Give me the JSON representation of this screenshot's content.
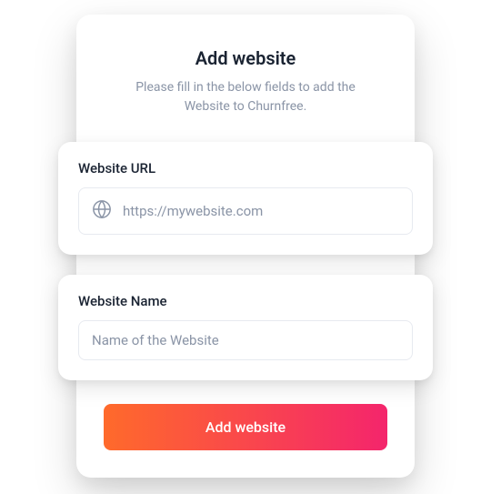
{
  "modal": {
    "title": "Add website",
    "subtitle": "Please fill in the below fields to add the Website to Churnfree."
  },
  "fields": {
    "url": {
      "label": "Website URL",
      "placeholder": "https://mywebsite.com",
      "value": ""
    },
    "name": {
      "label": "Website Name",
      "placeholder": "Name of the Website",
      "value": ""
    }
  },
  "button": {
    "submit_label": "Add website"
  }
}
